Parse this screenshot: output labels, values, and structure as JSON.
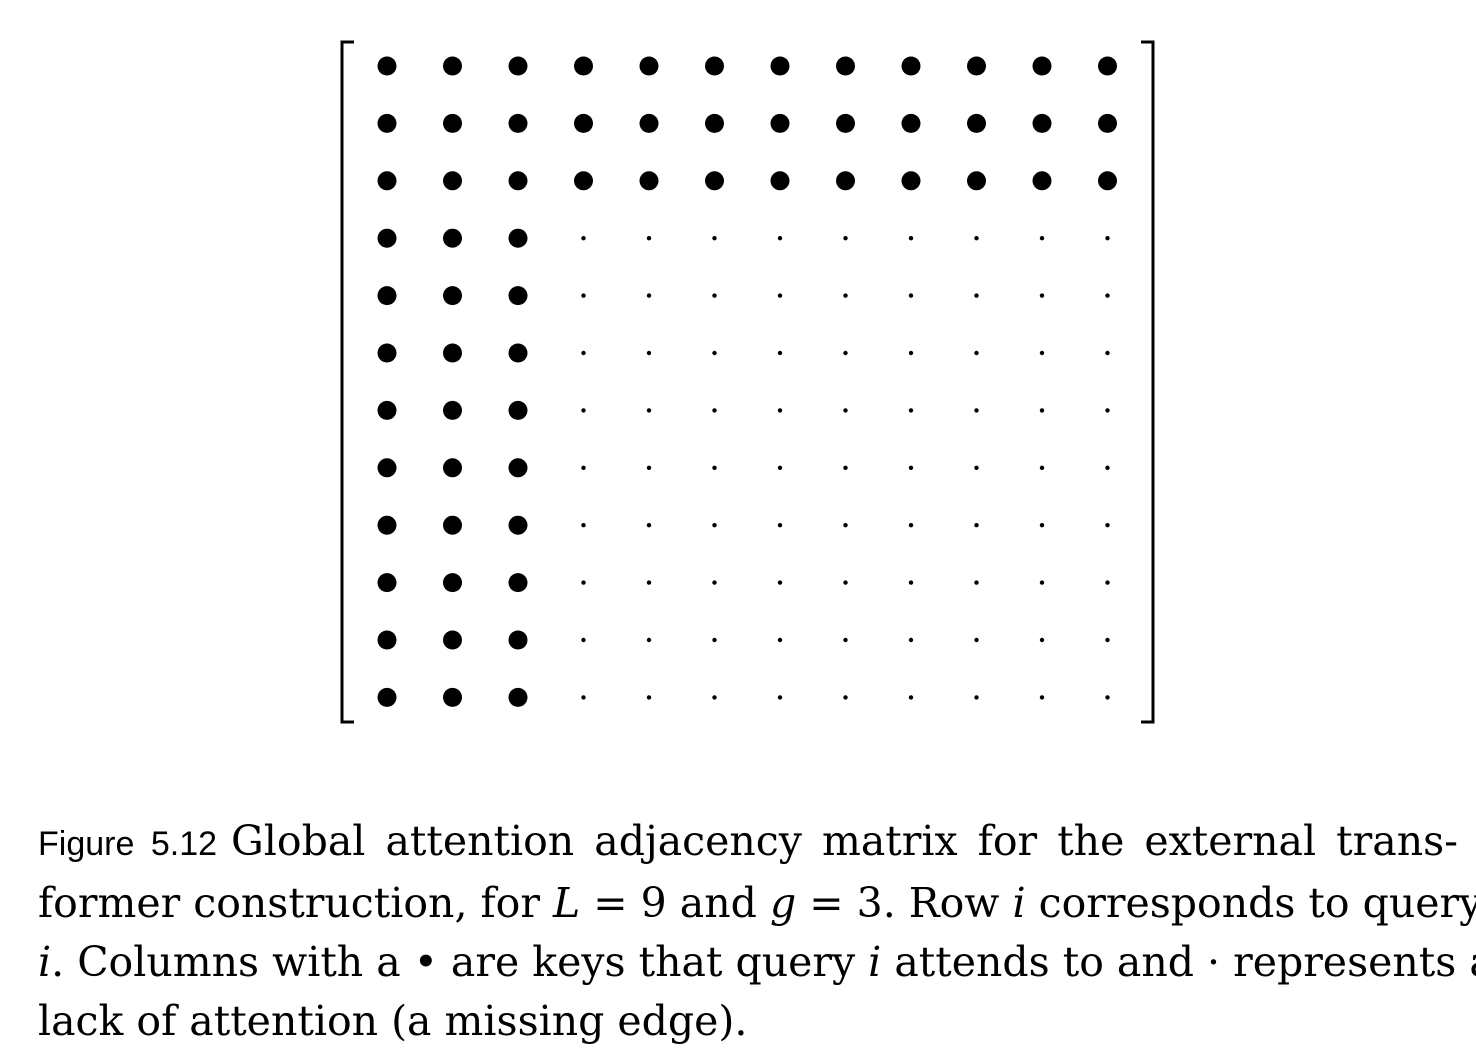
{
  "figure": {
    "matrix": {
      "rows": 12,
      "cols": 12,
      "global_count": 3,
      "attended_symbol": "•",
      "missing_symbol": "·"
    },
    "caption": {
      "label": "Figure 5.12",
      "line1": "Global attention adjacency matrix for the external trans-",
      "line2_a": "former construction, for",
      "line2_L": "L",
      "line2_eq1": " = 9 and ",
      "line2_g": "g",
      "line2_eq2": " = 3. Row ",
      "line2_i": "i",
      "line2_b": " corresponds to query",
      "line3_i": "i",
      "line3_a": ". Columns with a • are keys that query ",
      "line3_i2": "i",
      "line3_b": " attends to and · represents a",
      "line4": "lack of attention (a missing edge)."
    }
  }
}
